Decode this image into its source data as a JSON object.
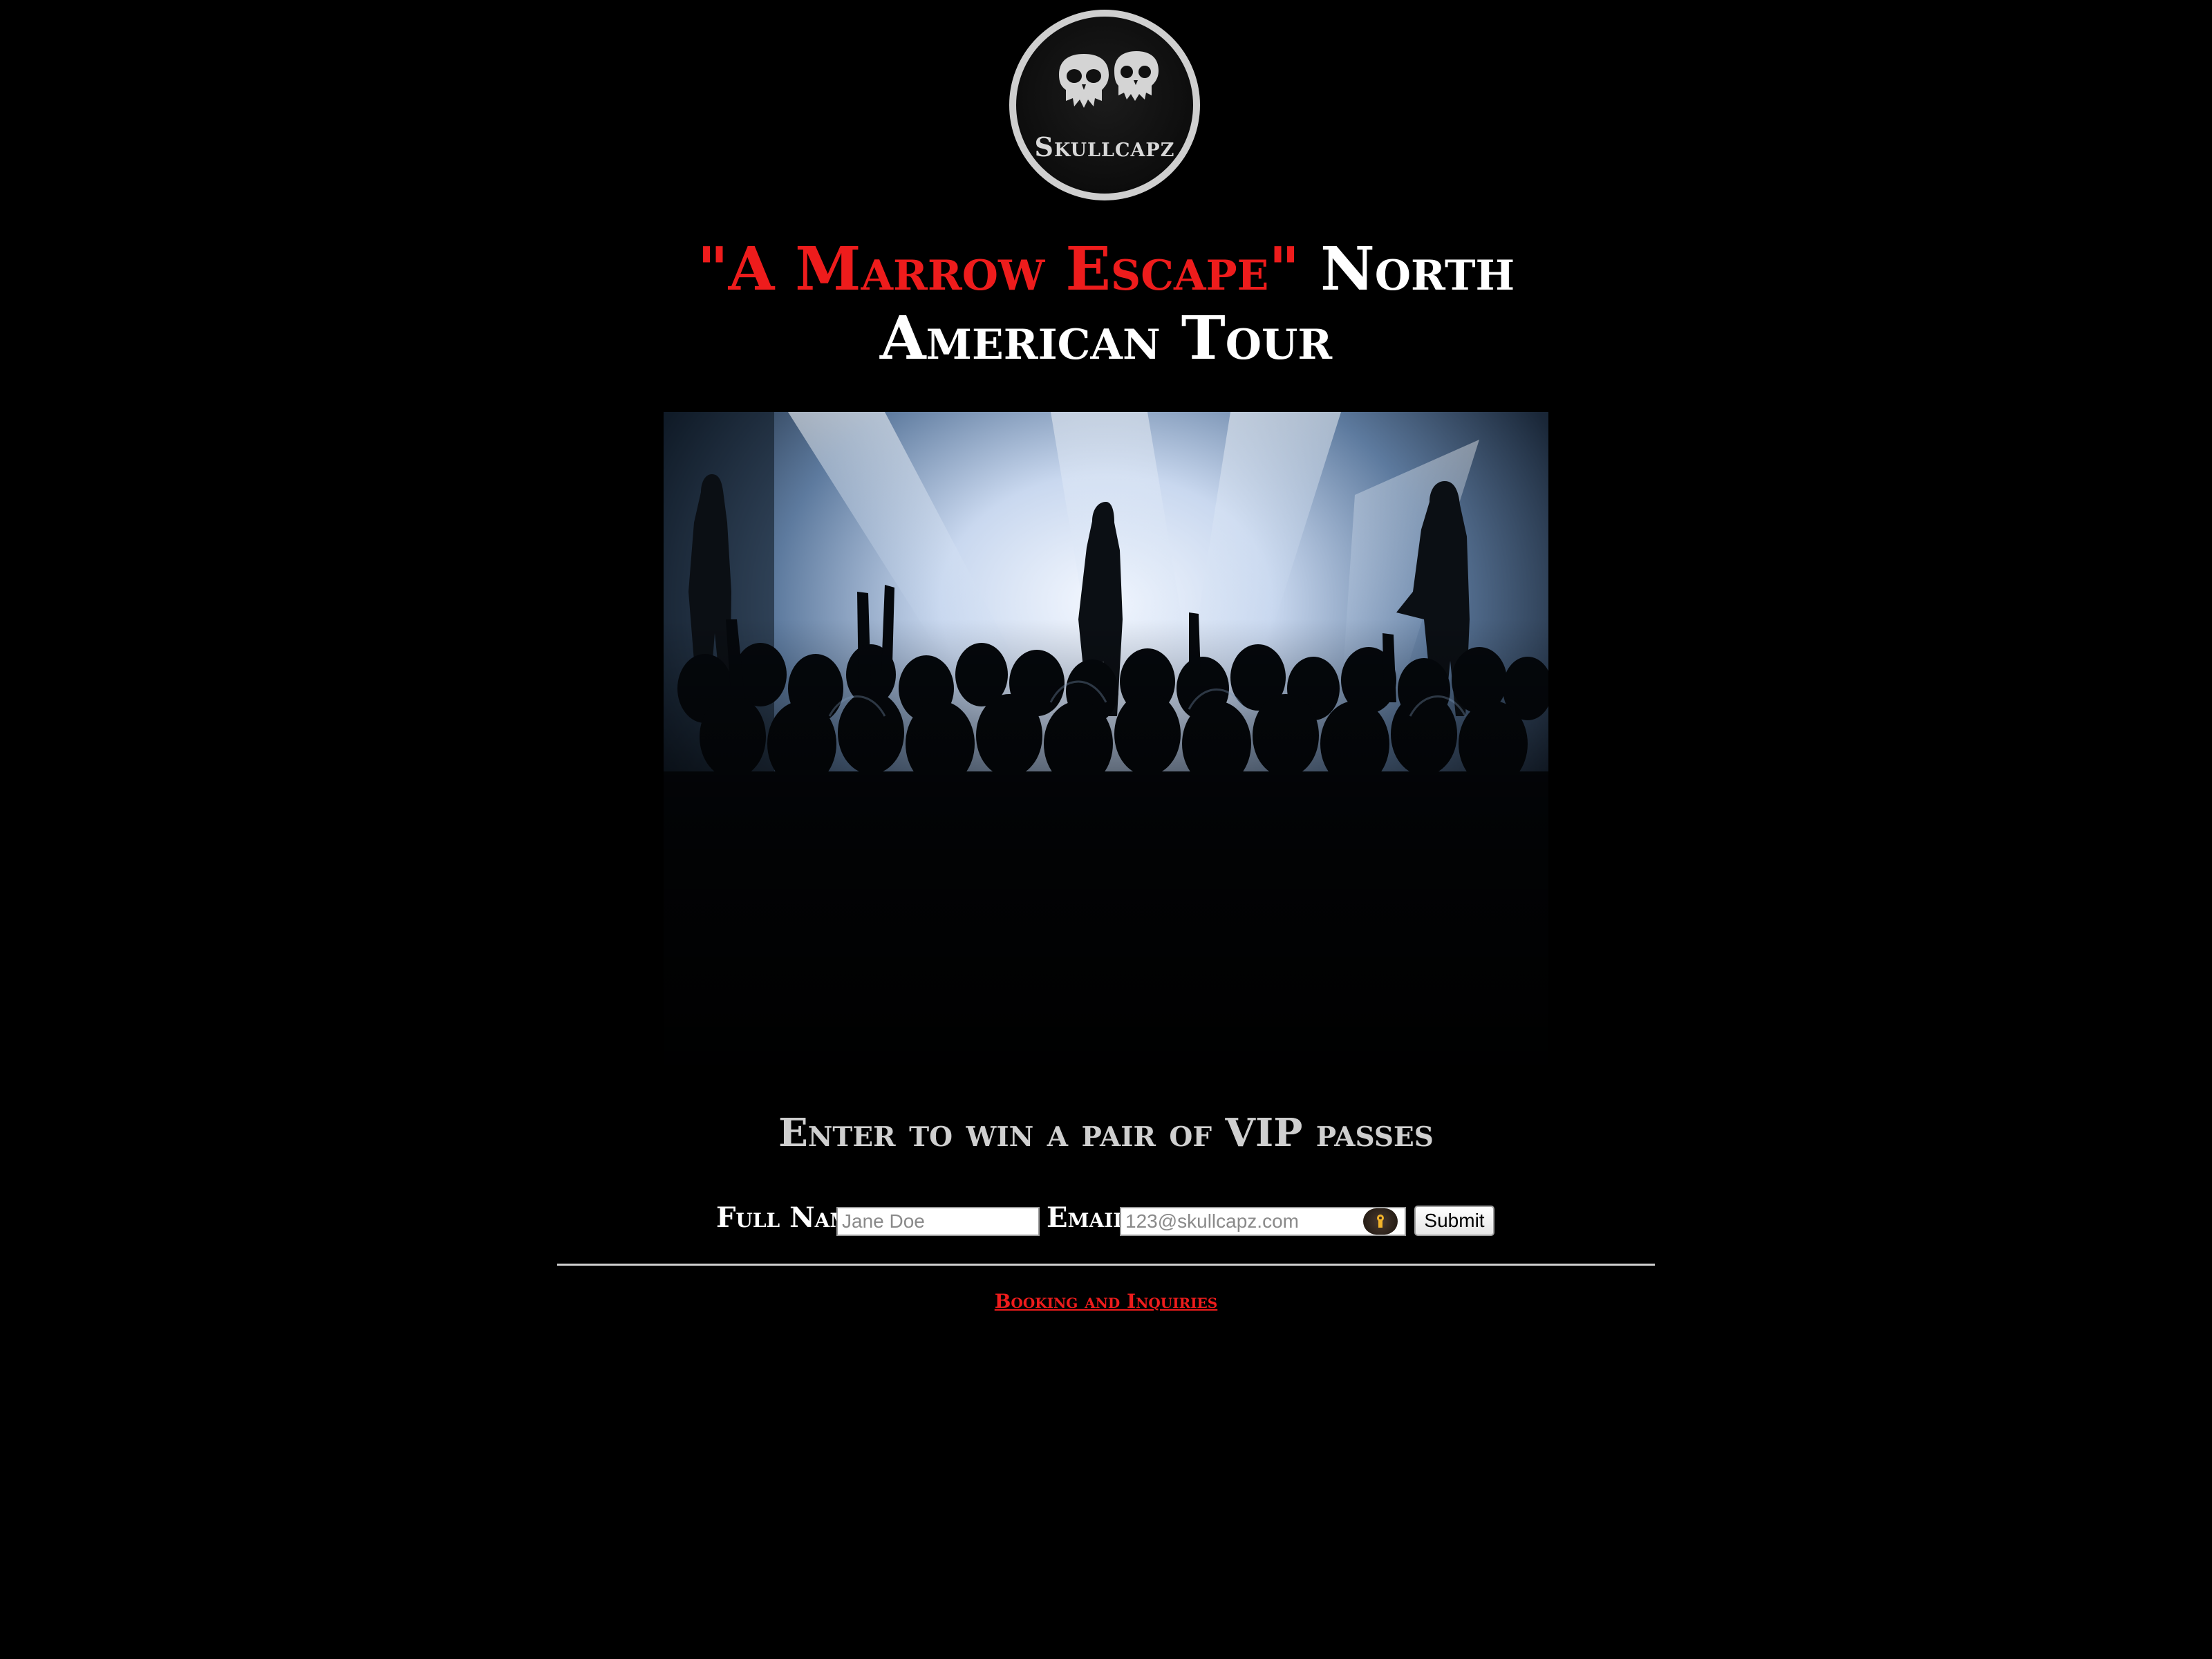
{
  "brand": {
    "logo_text": "Skullcapz"
  },
  "header": {
    "title_highlight": "\"A Marrow Escape\"",
    "title_rest": "North American Tour"
  },
  "main": {
    "subtitle": "Enter to win a pair of VIP passes"
  },
  "form": {
    "name_label": "Full Name:",
    "name_placeholder": "Jane Doe",
    "email_label": "Email:",
    "email_placeholder": "123@skullcapz.com",
    "submit_label": "Submit"
  },
  "footer": {
    "link_text": "Booking and Inquiries"
  },
  "colors": {
    "background": "#000000",
    "accent": "#ee1c1c",
    "text": "#ffffff"
  }
}
